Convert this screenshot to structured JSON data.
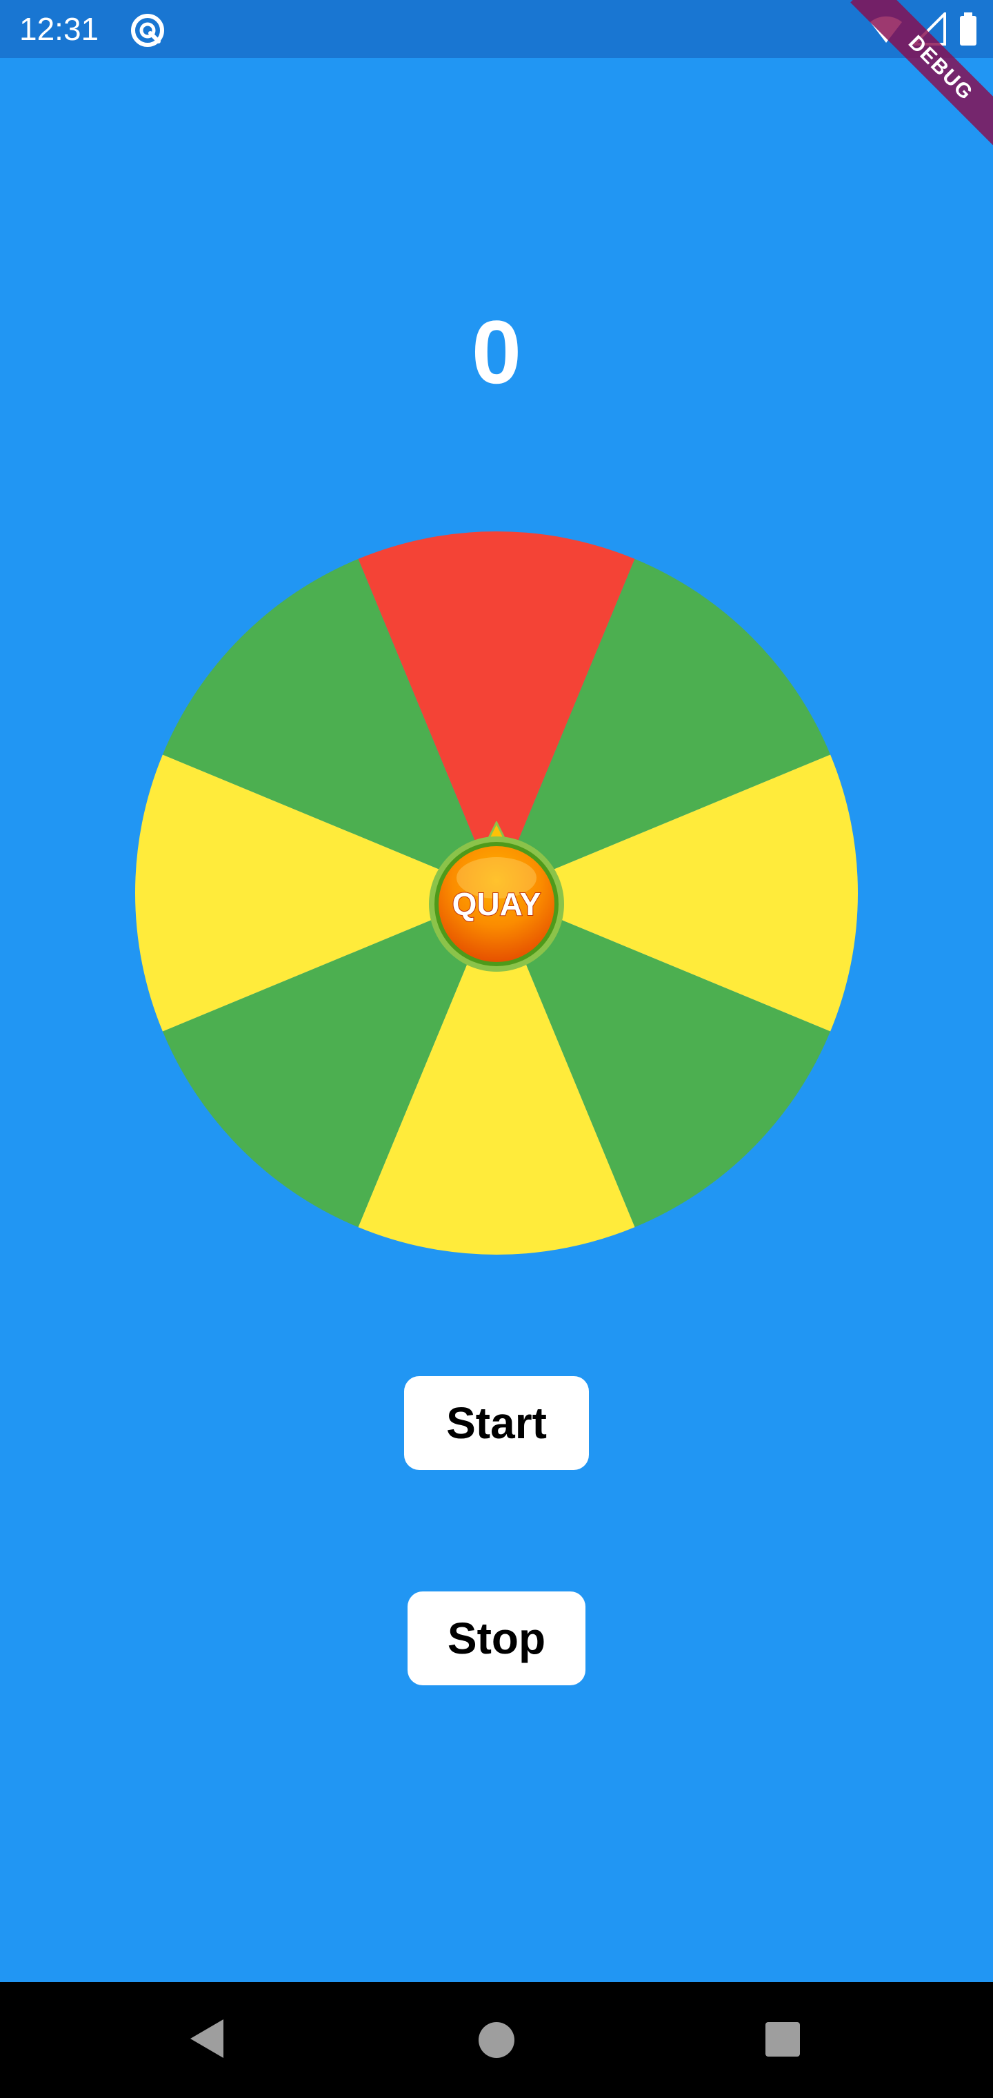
{
  "status_bar": {
    "time": "12:31",
    "app_icon": "quay-app-icon",
    "icons": [
      "wifi-icon",
      "signal-icon",
      "battery-icon"
    ]
  },
  "debug_banner": "DEBUG",
  "counter": {
    "value": "0"
  },
  "wheel": {
    "segment_colors": [
      "#F44336",
      "#4CAF50",
      "#FFEB3B",
      "#4CAF50",
      "#FFEB3B",
      "#4CAF50",
      "#FFEB3B",
      "#4CAF50"
    ],
    "hub_label": "QUAY",
    "hub_colors": {
      "ring": "#7CC22B",
      "ring_dark": "#4E9A1A",
      "fill_top": "#FFA000",
      "fill_bottom": "#EF6C00"
    }
  },
  "buttons": {
    "start_label": "Start",
    "stop_label": "Stop"
  },
  "nav_bar": {
    "icons": [
      "back-icon",
      "home-icon",
      "recents-icon"
    ]
  },
  "colors": {
    "background": "#2196F3",
    "status_bar": "#1976D2",
    "debug_ribbon": "#880E4F"
  }
}
